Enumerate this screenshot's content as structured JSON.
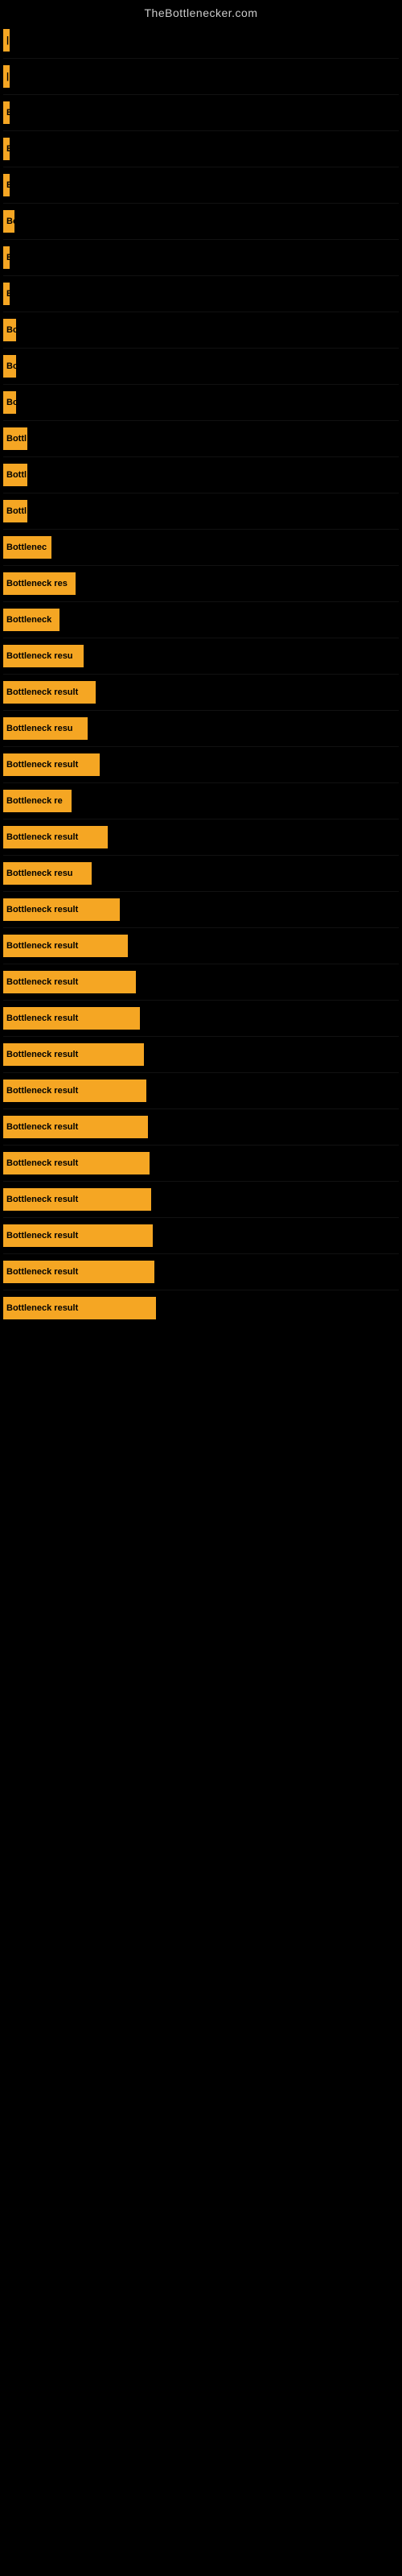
{
  "site_title": "TheBottlenecker.com",
  "bars": [
    {
      "id": 1,
      "label": "|",
      "width": 4
    },
    {
      "id": 2,
      "label": "|",
      "width": 4
    },
    {
      "id": 3,
      "label": "E",
      "width": 8
    },
    {
      "id": 4,
      "label": "B",
      "width": 8
    },
    {
      "id": 5,
      "label": "E",
      "width": 8
    },
    {
      "id": 6,
      "label": "Bo",
      "width": 14
    },
    {
      "id": 7,
      "label": "B",
      "width": 8
    },
    {
      "id": 8,
      "label": "B",
      "width": 8
    },
    {
      "id": 9,
      "label": "Bo",
      "width": 16
    },
    {
      "id": 10,
      "label": "Bo",
      "width": 16
    },
    {
      "id": 11,
      "label": "Bo",
      "width": 16
    },
    {
      "id": 12,
      "label": "Bottl",
      "width": 30
    },
    {
      "id": 13,
      "label": "Bottl",
      "width": 30
    },
    {
      "id": 14,
      "label": "Bottl",
      "width": 30
    },
    {
      "id": 15,
      "label": "Bottlenec",
      "width": 60
    },
    {
      "id": 16,
      "label": "Bottleneck res",
      "width": 90
    },
    {
      "id": 17,
      "label": "Bottleneck",
      "width": 70
    },
    {
      "id": 18,
      "label": "Bottleneck resu",
      "width": 100
    },
    {
      "id": 19,
      "label": "Bottleneck result",
      "width": 115
    },
    {
      "id": 20,
      "label": "Bottleneck resu",
      "width": 105
    },
    {
      "id": 21,
      "label": "Bottleneck result",
      "width": 120
    },
    {
      "id": 22,
      "label": "Bottleneck re",
      "width": 85
    },
    {
      "id": 23,
      "label": "Bottleneck result",
      "width": 130
    },
    {
      "id": 24,
      "label": "Bottleneck resu",
      "width": 110
    },
    {
      "id": 25,
      "label": "Bottleneck result",
      "width": 145
    },
    {
      "id": 26,
      "label": "Bottleneck result",
      "width": 155
    },
    {
      "id": 27,
      "label": "Bottleneck result",
      "width": 165
    },
    {
      "id": 28,
      "label": "Bottleneck result",
      "width": 170
    },
    {
      "id": 29,
      "label": "Bottleneck result",
      "width": 175
    },
    {
      "id": 30,
      "label": "Bottleneck result",
      "width": 178
    },
    {
      "id": 31,
      "label": "Bottleneck result",
      "width": 180
    },
    {
      "id": 32,
      "label": "Bottleneck result",
      "width": 182
    },
    {
      "id": 33,
      "label": "Bottleneck result",
      "width": 184
    },
    {
      "id": 34,
      "label": "Bottleneck result",
      "width": 186
    },
    {
      "id": 35,
      "label": "Bottleneck result",
      "width": 188
    },
    {
      "id": 36,
      "label": "Bottleneck result",
      "width": 190
    }
  ]
}
